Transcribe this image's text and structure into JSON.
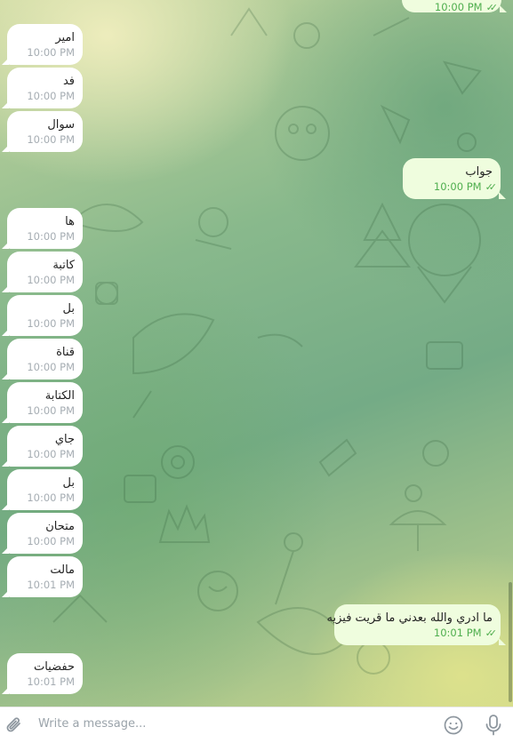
{
  "messages": [
    {
      "id": "m0",
      "dir": "out",
      "text": "",
      "time": "10:00 PM",
      "checks": "✓✓"
    },
    {
      "id": "m1",
      "dir": "in",
      "text": "امير",
      "time": "10:00 PM"
    },
    {
      "id": "m2",
      "dir": "in",
      "text": "فد",
      "time": "10:00 PM"
    },
    {
      "id": "m3",
      "dir": "in",
      "text": "سوال",
      "time": "10:00 PM"
    },
    {
      "id": "m4",
      "dir": "out",
      "text": "جواب",
      "time": "10:00 PM",
      "checks": "✓✓"
    },
    {
      "id": "m5",
      "dir": "in",
      "text": "ها",
      "time": "10:00 PM"
    },
    {
      "id": "m6",
      "dir": "in",
      "text": "كاتبة",
      "time": "10:00 PM"
    },
    {
      "id": "m7",
      "dir": "in",
      "text": "بل",
      "time": "10:00 PM"
    },
    {
      "id": "m8",
      "dir": "in",
      "text": "قناة",
      "time": "10:00 PM"
    },
    {
      "id": "m9",
      "dir": "in",
      "text": "الكتابة",
      "time": "10:00 PM"
    },
    {
      "id": "m10",
      "dir": "in",
      "text": "جاي",
      "time": "10:00 PM"
    },
    {
      "id": "m11",
      "dir": "in",
      "text": "بل",
      "time": "10:00 PM"
    },
    {
      "id": "m12",
      "dir": "in",
      "text": "متحان",
      "time": "10:00 PM"
    },
    {
      "id": "m13",
      "dir": "in",
      "text": "مالت",
      "time": "10:01 PM"
    },
    {
      "id": "m14",
      "dir": "out",
      "text": "ما ادري والله بعدني ما قريت فيزيه",
      "time": "10:01 PM",
      "checks": "✓✓"
    },
    {
      "id": "m15",
      "dir": "in",
      "text": "حفضيات",
      "time": "10:01 PM"
    }
  ],
  "composer": {
    "placeholder": "Write a message...",
    "attach_icon": "paperclip-icon",
    "emoji_icon": "emoji-icon",
    "voice_icon": "microphone-icon"
  },
  "colors": {
    "incoming_bubble": "#ffffff",
    "outgoing_bubble": "#effdde",
    "read_check": "#4fae4e",
    "time_gray": "#a6adb3"
  }
}
